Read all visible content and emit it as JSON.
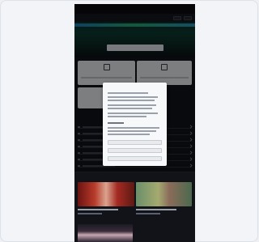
{
  "header": {
    "logo": "",
    "logo_sub": "",
    "buttons": [
      "",
      ""
    ]
  },
  "hero": {
    "title": "",
    "subtitle": "",
    "search_placeholder": ""
  },
  "tiles": [
    {
      "icon": "calendar-icon",
      "label": ""
    },
    {
      "icon": "hand-icon",
      "label": ""
    },
    {
      "icon": "list-icon",
      "label": ""
    }
  ],
  "list_section": {
    "heading": ""
  },
  "news": {
    "heading": ""
  },
  "modal": {
    "title": "",
    "buttons": [
      "",
      "",
      ""
    ]
  },
  "colors": {
    "background": "#111318",
    "accent_green": "#27c07f",
    "accent_blue": "#1d8bd6",
    "modal_bg": "#f7f8fa"
  }
}
